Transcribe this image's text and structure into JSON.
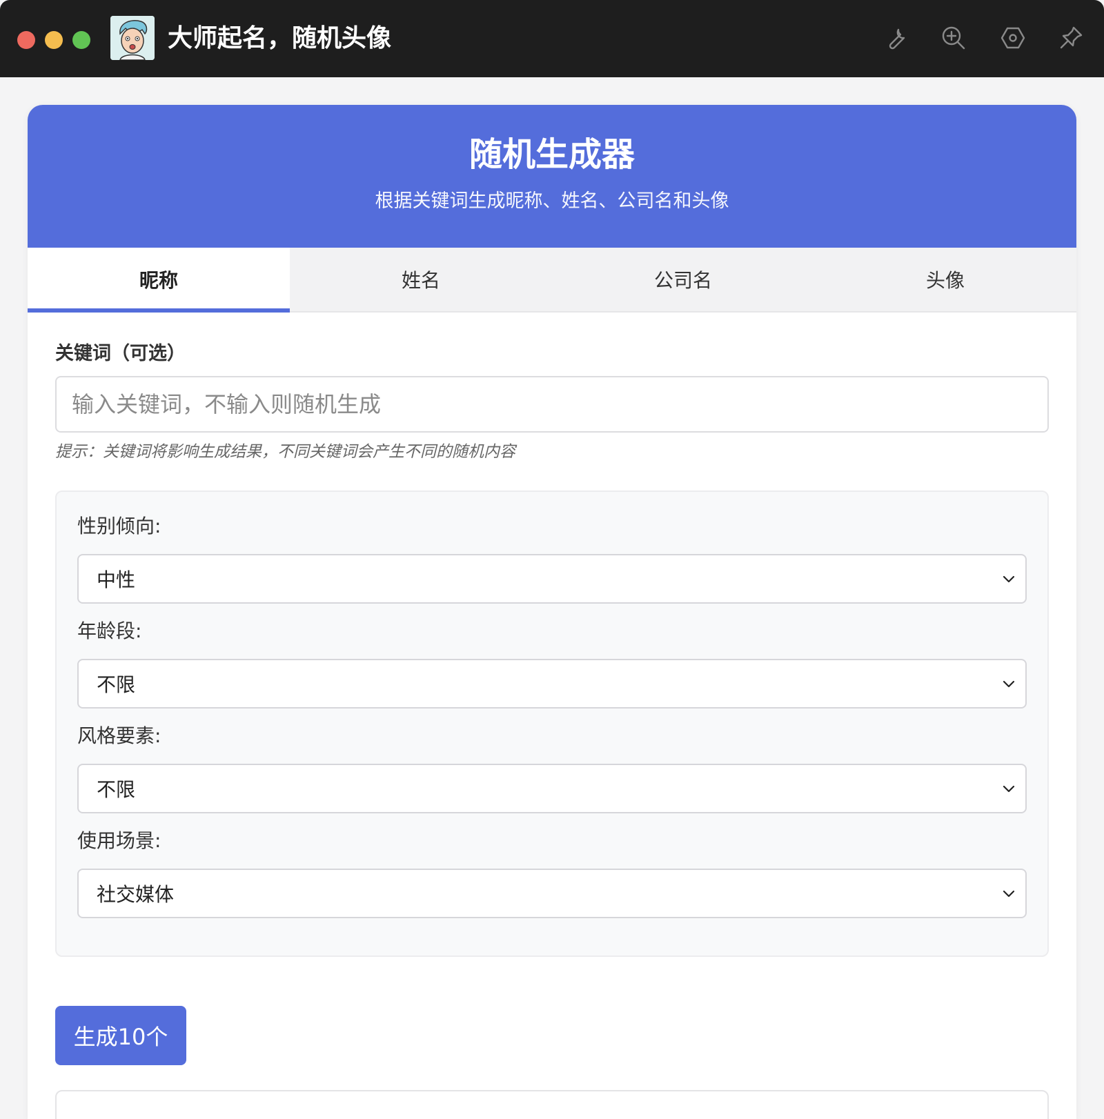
{
  "window": {
    "title": "大师起名，随机头像",
    "icons": [
      "wrench-icon",
      "zoom-in-icon",
      "settings-hex-icon",
      "pin-icon"
    ]
  },
  "header": {
    "title": "随机生成器",
    "subtitle": "根据关键词生成昵称、姓名、公司名和头像"
  },
  "tabs": [
    {
      "label": "昵称",
      "active": true
    },
    {
      "label": "姓名",
      "active": false
    },
    {
      "label": "公司名",
      "active": false
    },
    {
      "label": "头像",
      "active": false
    }
  ],
  "keyword": {
    "label": "关键词（可选）",
    "value": "",
    "placeholder": "输入关键词，不输入则随机生成",
    "hint": "提示：关键词将影响生成结果，不同关键词会产生不同的随机内容"
  },
  "options": [
    {
      "label": "性别倾向:",
      "selected": "中性"
    },
    {
      "label": "年龄段:",
      "selected": "不限"
    },
    {
      "label": "风格要素:",
      "selected": "不限"
    },
    {
      "label": "使用场景:",
      "selected": "社交媒体"
    }
  ],
  "actions": {
    "generate_label": "生成10个"
  },
  "colors": {
    "accent": "#546ddb",
    "titlebar": "#1e1e1e"
  }
}
